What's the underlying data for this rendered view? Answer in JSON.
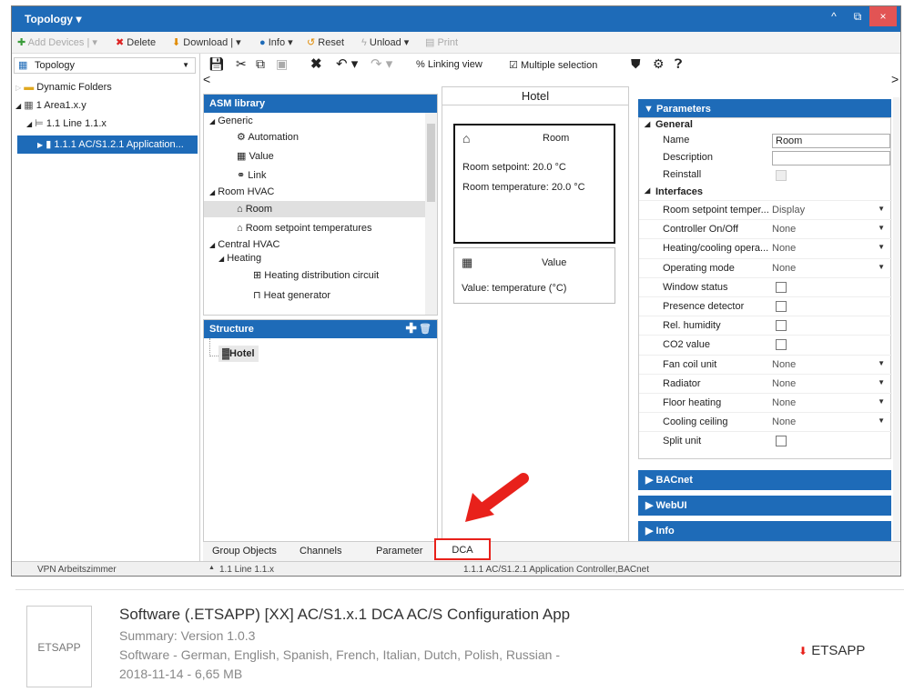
{
  "window": {
    "title": "Topology",
    "title_caret": "▾",
    "btn_up": "^",
    "btn_restore": "⧉",
    "btn_close": "×"
  },
  "toolbar": {
    "add_devices": "Add Devices",
    "delete": "Delete",
    "download": "Download",
    "info": "Info",
    "reset": "Reset",
    "unload": "Unload",
    "print": "Print"
  },
  "topology": {
    "header": "Topology",
    "items": [
      {
        "label": "Dynamic Folders"
      },
      {
        "label": "1 Area1.x.y"
      },
      {
        "label": "1.1 Line 1.1.x"
      },
      {
        "label": "1.1.1 AC/S1.2.1 Application..."
      }
    ]
  },
  "secondary_toolbar": {
    "linking_view": "Linking view",
    "multiple_selection": "Multiple selection"
  },
  "asm_library": {
    "title": "ASM library",
    "items": [
      {
        "label": "Generic"
      },
      {
        "label": "Automation"
      },
      {
        "label": "Value"
      },
      {
        "label": "Link"
      },
      {
        "label": "Room HVAC"
      },
      {
        "label": "Room"
      },
      {
        "label": "Room setpoint temperatures"
      },
      {
        "label": "Central HVAC"
      },
      {
        "label": "Heating"
      },
      {
        "label": "Heating distribution circuit"
      },
      {
        "label": "Heat generator"
      }
    ]
  },
  "structure": {
    "title": "Structure",
    "root": "Hotel"
  },
  "center": {
    "title": "Hotel",
    "cards": [
      {
        "title": "Room",
        "lines": [
          "Room setpoint: 20.0 °C",
          "Room temperature: 20.0 °C"
        ]
      },
      {
        "title": "Value",
        "lines": [
          "Value: temperature (°C)"
        ]
      }
    ]
  },
  "parameters": {
    "title": "Parameters",
    "general": "General",
    "name_label": "Name",
    "name_value": "Room",
    "description_label": "Description",
    "reinstall_label": "Reinstall",
    "interfaces": "Interfaces",
    "rows": [
      {
        "label": "Room setpoint temper...",
        "value": "Display"
      },
      {
        "label": "Controller On/Off",
        "value": "None"
      },
      {
        "label": "Heating/cooling opera...",
        "value": "None"
      },
      {
        "label": "Operating mode",
        "value": "None"
      },
      {
        "label": "Window status",
        "value": ""
      },
      {
        "label": "Presence detector",
        "value": ""
      },
      {
        "label": "Rel. humidity",
        "value": ""
      },
      {
        "label": "CO2 value",
        "value": ""
      },
      {
        "label": "Fan coil unit",
        "value": "None"
      },
      {
        "label": "Radiator",
        "value": "None"
      },
      {
        "label": "Floor heating",
        "value": "None"
      },
      {
        "label": "Cooling ceiling",
        "value": "None"
      },
      {
        "label": "Split unit",
        "value": ""
      }
    ],
    "sections": [
      "BACnet",
      "WebUI",
      "Info"
    ]
  },
  "tabs": [
    "Group Objects",
    "Channels",
    "Parameter",
    "DCA"
  ],
  "status": {
    "left": "VPN Arbeitszimmer",
    "line": "1.1 Line 1.1.x",
    "device": "1.1.1 AC/S1.2.1 Application Controller,BACnet"
  },
  "download_panel": {
    "icon_label": "ETSAPP",
    "title": "Software (.ETSAPP) [XX] AC/S1.x.1 DCA AC/S Configuration App",
    "summary": "Summary: Version 1.0.3",
    "languages": "Software - German, English, Spanish, French, Italian, Dutch, Polish, Russian -",
    "meta": "2018-11-14 - 6,65 MB",
    "link": "ETSAPP",
    "link_icon": "⬇"
  },
  "colors": {
    "accent": "#1e6bb8",
    "highlight": "#e8211b"
  }
}
